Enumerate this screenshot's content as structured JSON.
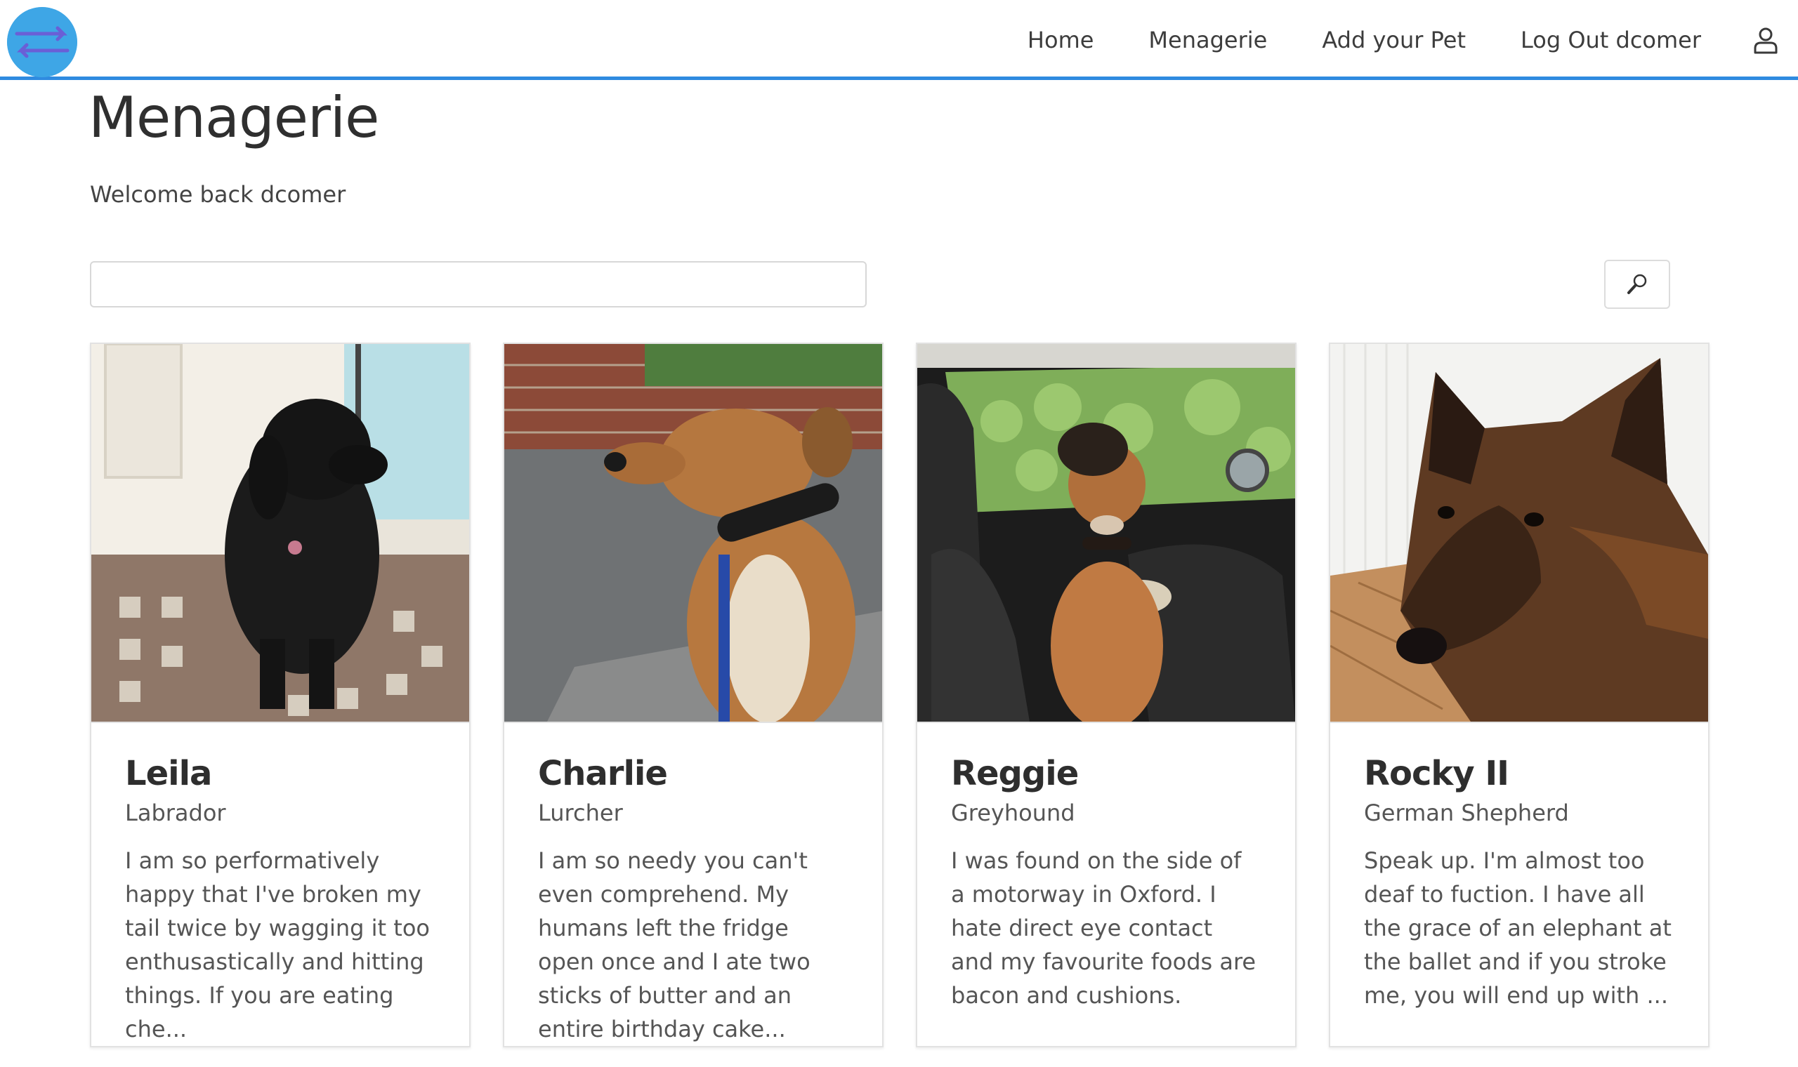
{
  "nav": {
    "links": [
      "Home",
      "Menagerie",
      "Add your Pet",
      "Log Out dcomer"
    ],
    "accent_color": "#2f8be0",
    "logo_color": "#3ea6e6"
  },
  "main": {
    "title": "Menagerie",
    "welcome": "Welcome back dcomer",
    "search": {
      "value": "",
      "placeholder": ""
    }
  },
  "pets": [
    {
      "name": "Leila",
      "breed": "Labrador",
      "description": "I am so performatively happy that I've broken my tail twice by wagging it too enthusastically and hitting things. If you are eating che..."
    },
    {
      "name": "Charlie",
      "breed": "Lurcher",
      "description": "I am so needy you can't even comprehend. My humans left the fridge open once and I ate two sticks of butter and an entire birthday cake..."
    },
    {
      "name": "Reggie",
      "breed": "Greyhound",
      "description": "I was found on the side of a motorway in Oxford. I hate direct eye contact and my favourite foods are bacon and cushions."
    },
    {
      "name": "Rocky II",
      "breed": "German Shepherd",
      "description": "Speak up. I'm almost too deaf to fuction. I have all the grace of an elephant at the ballet and if you stroke me, you will end up with ..."
    }
  ]
}
